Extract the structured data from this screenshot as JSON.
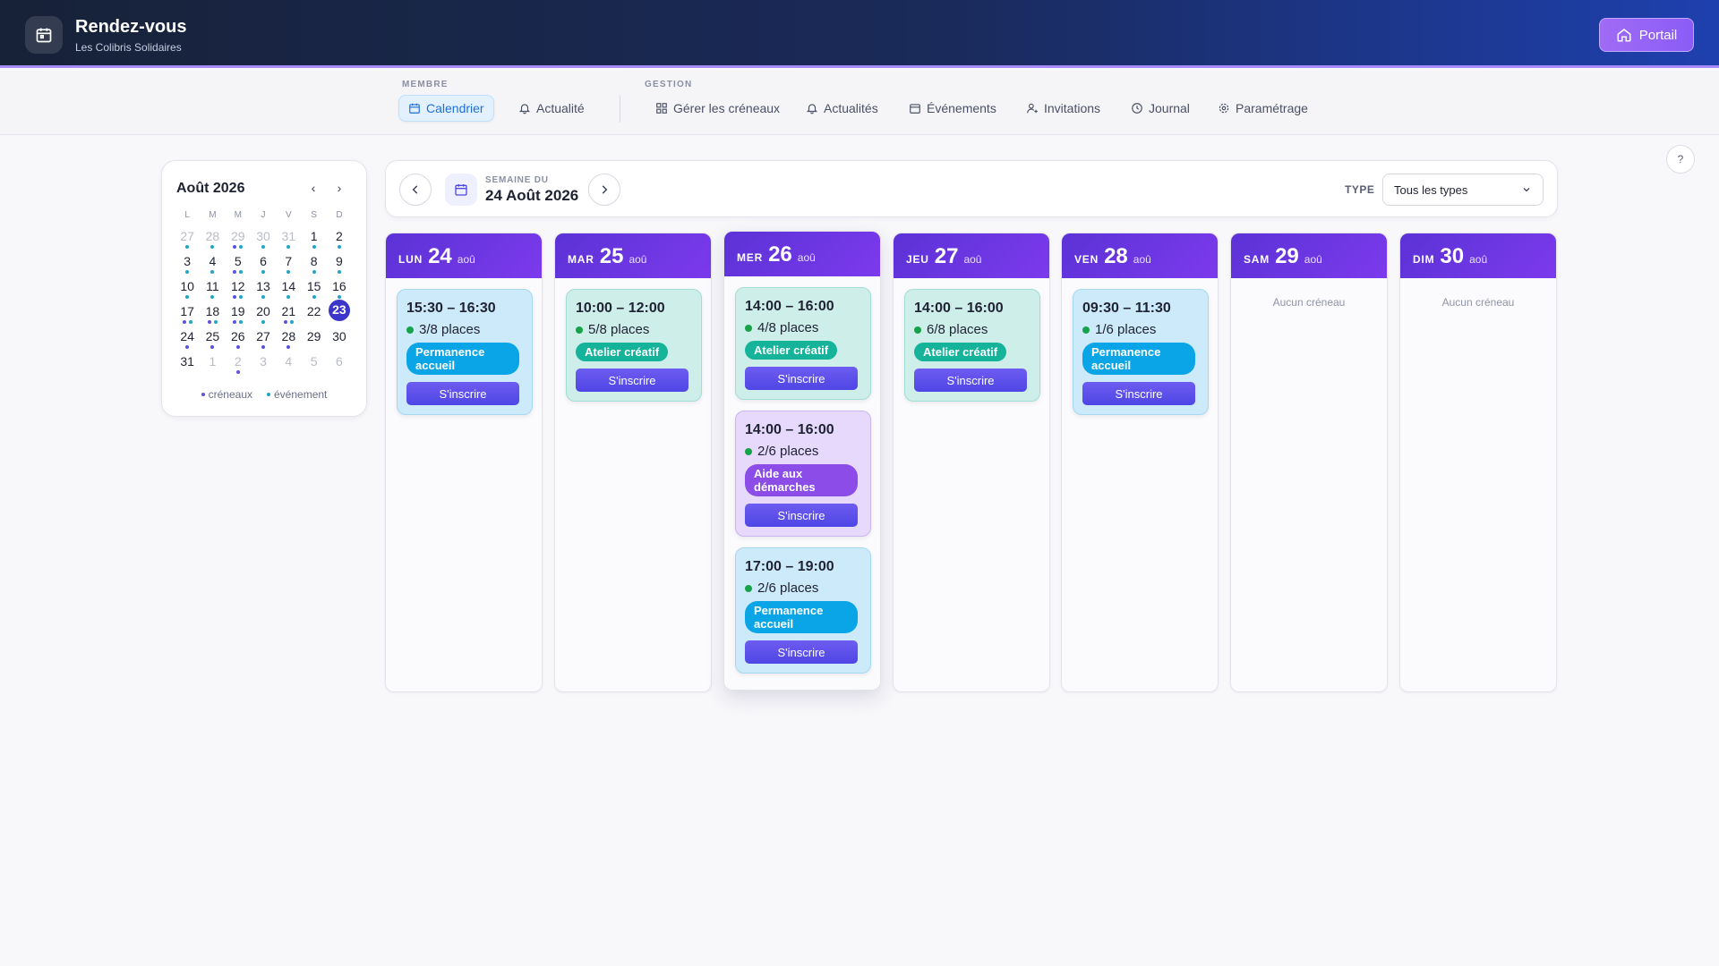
{
  "app": {
    "title": "Rendez-vous",
    "subtitle": "Les Colibris Solidaires",
    "portal_label": "Portail"
  },
  "nav": {
    "membre_label": "MEMBRE",
    "gestion_label": "GESTION",
    "membre_items": [
      "Calendrier",
      "Actualité"
    ],
    "gestion_items": [
      "Gérer les créneaux",
      "Actualités",
      "Événements",
      "Invitations",
      "Journal",
      "Paramétrage"
    ],
    "active": "Calendrier"
  },
  "help_label": "?",
  "minical": {
    "title": "Août 2026",
    "weekdays": [
      "L",
      "M",
      "M",
      "J",
      "V",
      "S",
      "D"
    ],
    "weeks": [
      [
        {
          "d": "27",
          "m": true,
          "dots": [
            "ev"
          ]
        },
        {
          "d": "28",
          "m": true,
          "dots": [
            "ev"
          ]
        },
        {
          "d": "29",
          "m": true,
          "dots": [
            "cr",
            "ev"
          ]
        },
        {
          "d": "30",
          "m": true,
          "dots": [
            "ev"
          ]
        },
        {
          "d": "31",
          "m": true,
          "dots": [
            "ev"
          ]
        },
        {
          "d": "1",
          "dots": [
            "ev"
          ]
        },
        {
          "d": "2",
          "dots": [
            "ev"
          ]
        }
      ],
      [
        {
          "d": "3",
          "dots": [
            "ev"
          ]
        },
        {
          "d": "4",
          "dots": [
            "ev"
          ]
        },
        {
          "d": "5",
          "dots": [
            "cr",
            "ev"
          ]
        },
        {
          "d": "6",
          "dots": [
            "ev"
          ]
        },
        {
          "d": "7",
          "dots": [
            "ev"
          ]
        },
        {
          "d": "8",
          "dots": [
            "ev"
          ]
        },
        {
          "d": "9",
          "dots": [
            "ev"
          ]
        }
      ],
      [
        {
          "d": "10",
          "dots": [
            "ev"
          ]
        },
        {
          "d": "11",
          "dots": [
            "ev"
          ]
        },
        {
          "d": "12",
          "dots": [
            "cr",
            "ev"
          ]
        },
        {
          "d": "13",
          "dots": [
            "ev"
          ]
        },
        {
          "d": "14",
          "dots": [
            "ev"
          ]
        },
        {
          "d": "15",
          "dots": [
            "ev"
          ]
        },
        {
          "d": "16",
          "dots": [
            "ev"
          ]
        }
      ],
      [
        {
          "d": "17",
          "dots": [
            "cr",
            "ev"
          ]
        },
        {
          "d": "18",
          "dots": [
            "cr",
            "ev"
          ]
        },
        {
          "d": "19",
          "dots": [
            "cr",
            "ev"
          ]
        },
        {
          "d": "20",
          "dots": [
            "ev"
          ]
        },
        {
          "d": "21",
          "dots": [
            "cr",
            "ev"
          ]
        },
        {
          "d": "22",
          "dots": []
        },
        {
          "d": "23",
          "today": true,
          "dots": []
        }
      ],
      [
        {
          "d": "24",
          "dots": [
            "cr"
          ]
        },
        {
          "d": "25",
          "dots": [
            "cr"
          ]
        },
        {
          "d": "26",
          "dots": [
            "cr"
          ]
        },
        {
          "d": "27",
          "dots": [
            "cr"
          ]
        },
        {
          "d": "28",
          "dots": [
            "cr"
          ]
        },
        {
          "d": "29",
          "dots": []
        },
        {
          "d": "30",
          "dots": []
        }
      ],
      [
        {
          "d": "31",
          "dots": []
        },
        {
          "d": "1",
          "m": true,
          "dots": []
        },
        {
          "d": "2",
          "m": true,
          "dots": [
            "cr"
          ]
        },
        {
          "d": "3",
          "m": true,
          "dots": []
        },
        {
          "d": "4",
          "m": true,
          "dots": []
        },
        {
          "d": "5",
          "m": true,
          "dots": []
        },
        {
          "d": "6",
          "m": true,
          "dots": []
        }
      ]
    ],
    "legend_creneaux": "créneaux",
    "legend_evenement": "événement",
    "colors": {
      "creneaux": "#5b52e0",
      "evenement": "#1fa6c9",
      "today": "#3b35c8"
    }
  },
  "week": {
    "label": "SEMAINE DU",
    "date": "24 Août 2026",
    "type_label": "TYPE",
    "type_value": "Tous les types"
  },
  "empty_label": "Aucun créneau",
  "register_label": "S'inscrire",
  "days": [
    {
      "name": "LUN",
      "num": "24",
      "month": "aoû",
      "slots": [
        {
          "time": "15:30 – 16:30",
          "places": "3/8 places",
          "type": "Permanence accueil",
          "kind": "perm"
        }
      ]
    },
    {
      "name": "MAR",
      "num": "25",
      "month": "aoû",
      "slots": [
        {
          "time": "10:00 – 12:00",
          "places": "5/8 places",
          "type": "Atelier créatif",
          "kind": "atel"
        }
      ]
    },
    {
      "name": "MER",
      "num": "26",
      "month": "aoû",
      "active": true,
      "slots": [
        {
          "time": "14:00 – 16:00",
          "places": "4/8 places",
          "type": "Atelier créatif",
          "kind": "atel"
        },
        {
          "time": "14:00 – 16:00",
          "places": "2/6 places",
          "type": "Aide aux démarches",
          "kind": "aide"
        },
        {
          "time": "17:00 – 19:00",
          "places": "2/6 places",
          "type": "Permanence accueil",
          "kind": "perm"
        }
      ]
    },
    {
      "name": "JEU",
      "num": "27",
      "month": "aoû",
      "slots": [
        {
          "time": "14:00 – 16:00",
          "places": "6/8 places",
          "type": "Atelier créatif",
          "kind": "atel"
        }
      ]
    },
    {
      "name": "VEN",
      "num": "28",
      "month": "aoû",
      "slots": [
        {
          "time": "09:30 – 11:30",
          "places": "1/6 places",
          "type": "Permanence accueil",
          "kind": "perm"
        }
      ]
    },
    {
      "name": "SAM",
      "num": "29",
      "month": "aoû",
      "slots": []
    },
    {
      "name": "DIM",
      "num": "30",
      "month": "aoû",
      "slots": []
    }
  ],
  "colors": {
    "header_purple": "#6d36e0",
    "accent_blue": "#1d6fd8",
    "button_indigo": "#4f46e5"
  }
}
